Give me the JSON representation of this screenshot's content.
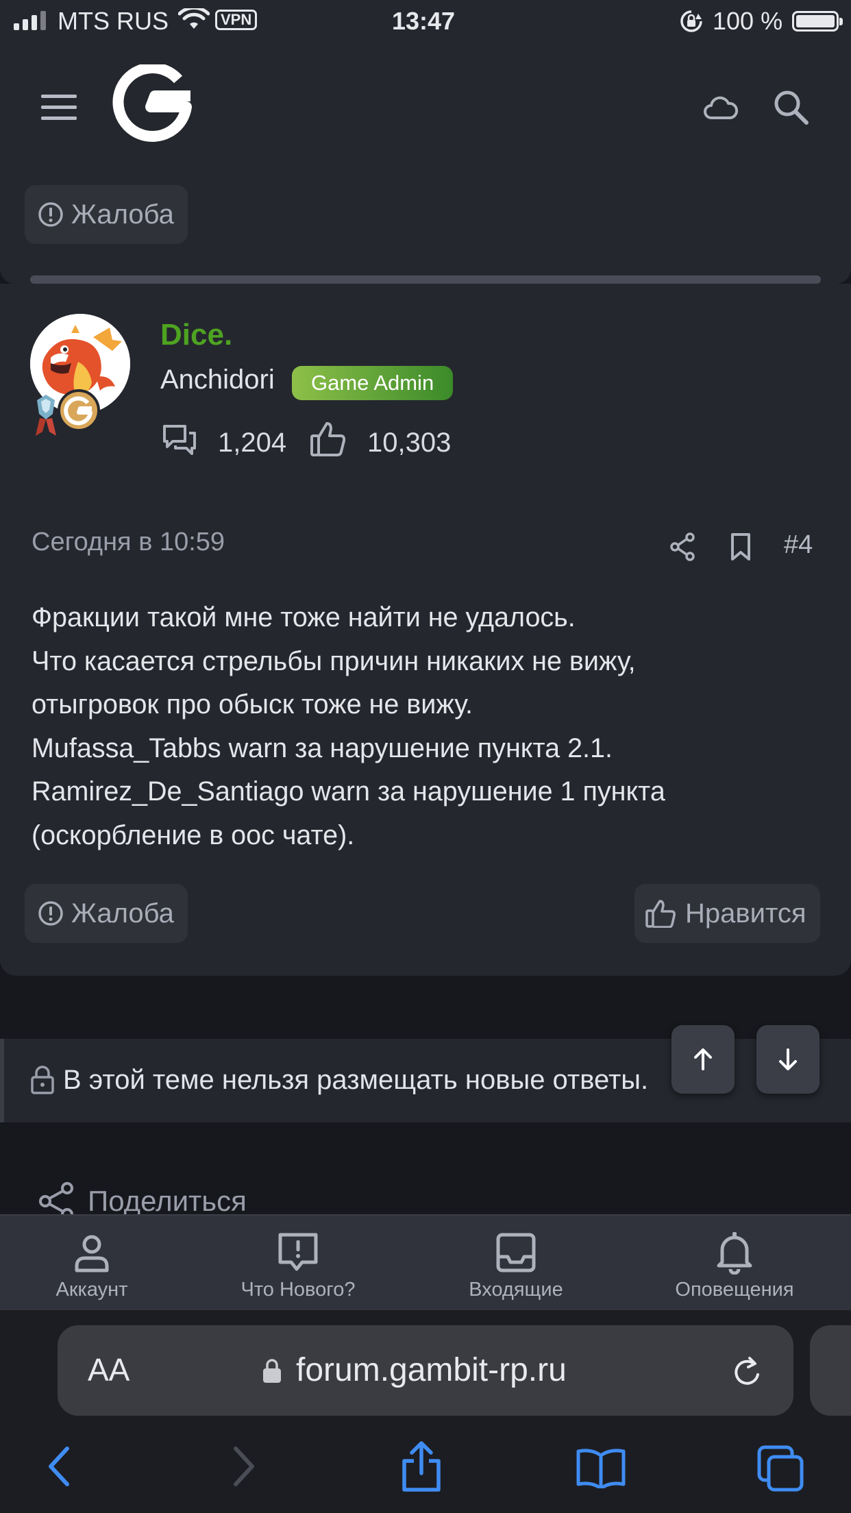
{
  "status_bar": {
    "carrier": "MTS RUS",
    "vpn": "VPN",
    "time": "13:47",
    "battery": "100 %",
    "icons": [
      "signal-icon",
      "wifi-icon",
      "rotation-lock-icon",
      "battery-icon"
    ]
  },
  "header": {
    "icons": [
      "menu-icon",
      "gambit-logo",
      "cloud-icon",
      "search-icon"
    ]
  },
  "previous_post": {
    "report_label": "Жалоба"
  },
  "post": {
    "username": "Dice.",
    "user_title": "Anchidori",
    "role_badge": "Game Admin",
    "messages_count": "1,204",
    "reactions_count": "10,303",
    "date": "Сегодня в 10:59",
    "post_number": "#4",
    "body_lines": [
      "Фракции такой мне тоже найти не удалось.",
      "Что касается стрельбы причин никаких не вижу,",
      "отыгровок про обыск тоже не вижу.",
      "Mufassa_Tabbs warn за нарушение пункта 2.1.",
      "Ramirez_De_Santiago warn за нарушение 1 пункта",
      "(оскорбление в оос чате)."
    ],
    "report_label": "Жалоба",
    "like_label": "Нравится"
  },
  "thread_notice": {
    "text": "В этой теме нельзя размещать новые ответы."
  },
  "share": {
    "label": "Поделиться"
  },
  "tabbar": {
    "items": [
      {
        "label": "Аккаунт",
        "icon": "account-icon"
      },
      {
        "label": "Что Нового?",
        "icon": "whats-new-icon"
      },
      {
        "label": "Входящие",
        "icon": "inbox-icon"
      },
      {
        "label": "Оповещения",
        "icon": "bell-icon"
      }
    ]
  },
  "browser": {
    "text_size": "AA",
    "url": "forum.gambit-rp.ru",
    "nav_icons": [
      "back-icon",
      "forward-icon",
      "share-icon",
      "bookmarks-icon",
      "tabs-icon"
    ]
  },
  "colors": {
    "background": "#17181d",
    "card": "#25272e",
    "username": "#4ea321",
    "role_badge_start": "#8ec049",
    "role_badge_end": "#3b8a2a",
    "safari_accent": "#3f8cf2"
  }
}
